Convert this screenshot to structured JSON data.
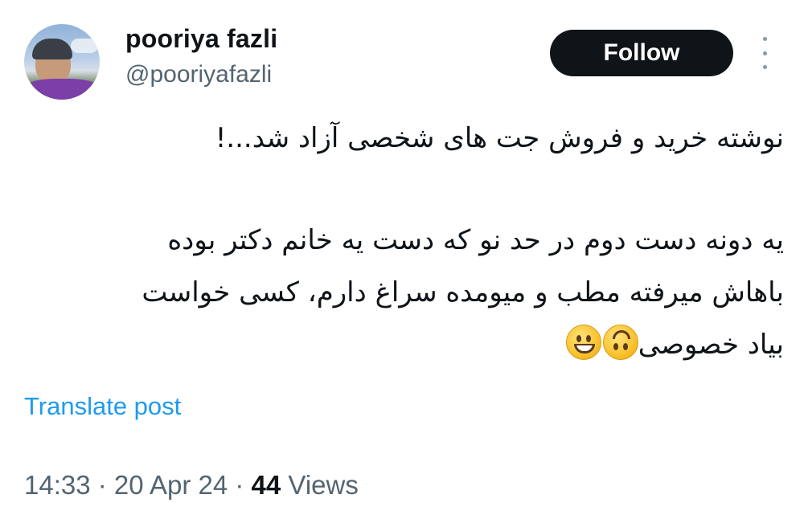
{
  "author": {
    "name": "pooriya fazli",
    "handle": "@pooriyafazli"
  },
  "actions": {
    "follow_label": "Follow",
    "more_icon": "more-vertical-icon"
  },
  "tweet": {
    "line1": "نوشته خرید و فروش جت های شخصی آزاد شد...!",
    "line2": "یه دونه دست دوم در حد نو که دست یه خانم دکتر بوده",
    "line3": "باهاش میرفته مطب و میومده سراغ دارم، کسی خواست",
    "line4": "بیاد خصوصی",
    "emojis": [
      "upside-down-face",
      "grinning-face"
    ]
  },
  "translate_label": "Translate post",
  "meta": {
    "time": "14:33",
    "sep1": " · ",
    "date": "20 Apr 24",
    "sep2": " · ",
    "views_count": "44",
    "views_label": " Views"
  },
  "colors": {
    "text": "#0f1419",
    "secondary": "#536471",
    "link": "#1d9bf0",
    "button_bg": "#0f1419"
  }
}
